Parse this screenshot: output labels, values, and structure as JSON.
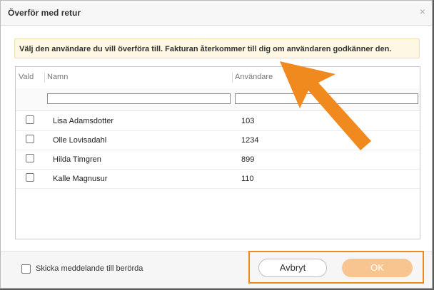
{
  "dialog": {
    "title": "Överför med retur",
    "close_glyph": "×",
    "info": "Välj den användare du vill överföra till. Fakturan återkommer till dig om användaren godkänner den."
  },
  "grid": {
    "columns": {
      "selected": "Vald",
      "name": "Namn",
      "user": "Användare"
    },
    "rows": [
      {
        "name": "Lisa Adamsdotter",
        "user": "103",
        "checked": false
      },
      {
        "name": "Olle Lovisadahl",
        "user": "1234",
        "checked": false
      },
      {
        "name": "Hilda Timgren",
        "user": "899",
        "checked": false
      },
      {
        "name": "Kalle Magnusur",
        "user": "110",
        "checked": false
      }
    ]
  },
  "footer": {
    "notify_label": "Skicka meddelande till berörda",
    "cancel_label": "Avbryt",
    "ok_label": "OK"
  },
  "colors": {
    "accent": "#f08a1e",
    "ok_disabled": "#f8c591",
    "info_bg": "#fdf7e3"
  }
}
